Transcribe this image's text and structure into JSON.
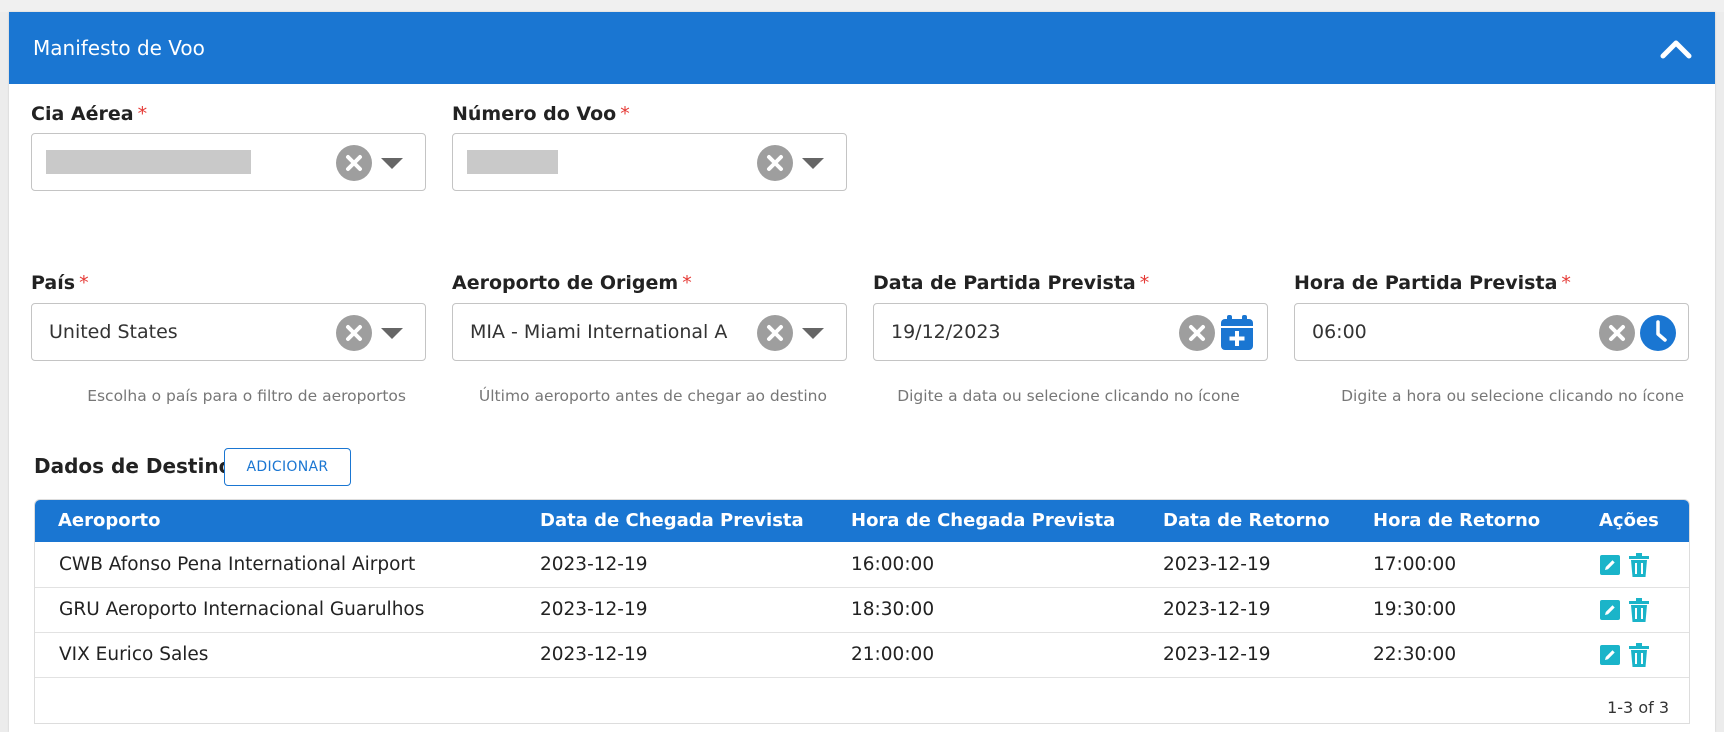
{
  "header": {
    "title": "Manifesto de Voo"
  },
  "fields": {
    "cia": {
      "label": "Cia Aérea",
      "required": "*"
    },
    "voo": {
      "label": "Número do Voo",
      "required": "*"
    },
    "pais": {
      "label": "País",
      "required": "*",
      "value": "United States",
      "helper": "Escolha o país para o filtro de aeroportos"
    },
    "origem": {
      "label": "Aeroporto de Origem",
      "required": "*",
      "value": "MIA - Miami International A",
      "helper": "Último aeroporto antes de chegar ao destino"
    },
    "data_partida": {
      "label": "Data de Partida Prevista",
      "required": "*",
      "value": "19/12/2023",
      "helper": "Digite a data ou selecione clicando no ícone"
    },
    "hora_partida": {
      "label": "Hora de Partida Prevista",
      "required": "*",
      "value": "06:00",
      "helper": "Digite a hora ou selecione clicando no ícone"
    }
  },
  "destino": {
    "title": "Dados de Destino",
    "add_label": "ADICIONAR",
    "columns": [
      "Aeroporto",
      "Data de Chegada Prevista",
      "Hora de Chegada Prevista",
      "Data de Retorno",
      "Hora de Retorno",
      "Ações"
    ],
    "rows": [
      [
        "CWB Afonso Pena International Airport",
        "2023-12-19",
        "16:00:00",
        "2023-12-19",
        "17:00:00"
      ],
      [
        "GRU Aeroporto Internacional Guarulhos",
        "2023-12-19",
        "18:30:00",
        "2023-12-19",
        "19:30:00"
      ],
      [
        "VIX Eurico Sales",
        "2023-12-19",
        "21:00:00",
        "2023-12-19",
        "22:30:00"
      ]
    ],
    "pagination": "1-3 of 3"
  },
  "colors": {
    "primary": "#1a76d2",
    "required": "#e53935",
    "action": "#1ab4c9",
    "clear": "#9e9e9e"
  },
  "icons": {
    "collapse": "chevron-up-icon",
    "clear": "close-circle-icon",
    "dropdown": "caret-down-icon",
    "calendar": "calendar-plus-icon",
    "clock": "clock-icon",
    "edit": "edit-icon",
    "delete": "trash-icon"
  }
}
